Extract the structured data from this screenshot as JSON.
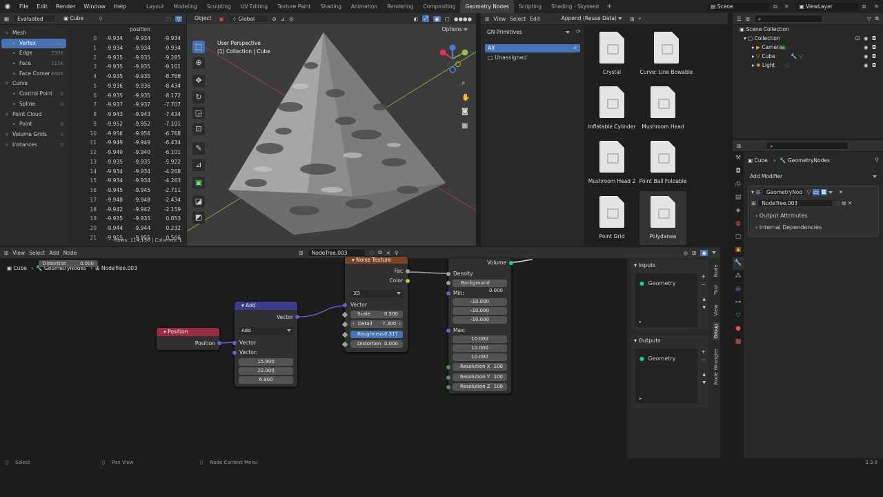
{
  "topbar": {
    "menus": [
      "File",
      "Edit",
      "Render",
      "Window",
      "Help"
    ],
    "workspaces": [
      "Layout",
      "Modeling",
      "Sculpting",
      "UV Editing",
      "Texture Paint",
      "Shading",
      "Animation",
      "Rendering",
      "Compositing",
      "Geometry Nodes",
      "Scripting",
      "Shading - Skyseed"
    ],
    "active_workspace": "Geometry Nodes",
    "scene": "Scene",
    "view_layer": "ViewLayer"
  },
  "spreadsheet": {
    "mode": "Evaluated",
    "object": "Cube",
    "column_header": "position",
    "domains": [
      {
        "label": "Mesh",
        "count": "",
        "indent": 0
      },
      {
        "label": "Vertex",
        "count": "114K",
        "indent": 1,
        "selected": true
      },
      {
        "label": "Edge",
        "count": "230K",
        "indent": 1
      },
      {
        "label": "Face",
        "count": "115K",
        "indent": 1
      },
      {
        "label": "Face Corner",
        "count": "460K",
        "indent": 1
      },
      {
        "label": "Curve",
        "count": "",
        "indent": 0
      },
      {
        "label": "Control Point",
        "count": "0",
        "indent": 1
      },
      {
        "label": "Spline",
        "count": "0",
        "indent": 1
      },
      {
        "label": "Point Cloud",
        "count": "",
        "indent": 0
      },
      {
        "label": "Point",
        "count": "0",
        "indent": 1
      },
      {
        "label": "Volume Grids",
        "count": "0",
        "indent": 0
      },
      {
        "label": "Instances",
        "count": "0",
        "indent": 0
      }
    ],
    "rows": [
      [
        "0",
        "-9.934",
        "-9.934",
        "-9.934"
      ],
      [
        "1",
        "-9.934",
        "-9.934",
        "-9.934"
      ],
      [
        "2",
        "-9.935",
        "-9.935",
        "-9.285"
      ],
      [
        "3",
        "-9.935",
        "-9.935",
        "-9.101"
      ],
      [
        "4",
        "-9.935",
        "-9.935",
        "-8.768"
      ],
      [
        "5",
        "-9.936",
        "-9.936",
        "-8.434"
      ],
      [
        "6",
        "-9.935",
        "-9.935",
        "-8.172"
      ],
      [
        "7",
        "-9.937",
        "-9.937",
        "-7.707"
      ],
      [
        "8",
        "-9.943",
        "-9.943",
        "-7.434"
      ],
      [
        "9",
        "-9.952",
        "-9.952",
        "-7.101"
      ],
      [
        "10",
        "-9.956",
        "-9.956",
        "-6.768"
      ],
      [
        "11",
        "-9.949",
        "-9.949",
        "-6.434"
      ],
      [
        "12",
        "-9.940",
        "-9.940",
        "-6.101"
      ],
      [
        "13",
        "-9.935",
        "-9.935",
        "-5.922"
      ],
      [
        "14",
        "-9.934",
        "-9.934",
        "-4.268"
      ],
      [
        "15",
        "-9.934",
        "-9.934",
        "-4.263"
      ],
      [
        "16",
        "-9.945",
        "-9.945",
        "-2.711"
      ],
      [
        "17",
        "-9.948",
        "-9.948",
        "-2.434"
      ],
      [
        "18",
        "-9.942",
        "-9.942",
        "-2.159"
      ],
      [
        "19",
        "-9.935",
        "-9.935",
        "0.053"
      ],
      [
        "20",
        "-9.944",
        "-9.944",
        "0.232"
      ],
      [
        "21",
        "-9.955",
        "-9.955",
        "0.566"
      ]
    ],
    "footer_rows": "Rows: 114,130",
    "footer_cols": "Columns: 1"
  },
  "viewport": {
    "mode": "Object",
    "orientation": "Global",
    "options": "Options",
    "perspective": "User Perspective",
    "collection": "(1) Collection | Cube"
  },
  "filebrowser": {
    "menus": [
      "View",
      "Select",
      "Edit"
    ],
    "import_mode": "Append (Reuse Data)",
    "library": "GN Primitives",
    "catalog_all": "All",
    "catalog_unassigned": "Unassigned",
    "assets": [
      "Crystal",
      "Curve: Line Bowable",
      "Inflatable Cylinder",
      "Mushroom Head",
      "Mushroom Head 2",
      "Point Ball Foldable",
      "Point Grid",
      "Polydanea"
    ]
  },
  "outliner": {
    "root": "Scene Collection",
    "collection": "Collection",
    "items": [
      "Camera",
      "Cube",
      "Light"
    ]
  },
  "properties": {
    "object": "Cube",
    "modifier_crumb": "GeometryNodes",
    "add_modifier": "Add Modifier",
    "modifier_name": "GeometryNod",
    "tree_name": "NodeTree.003",
    "output_attributes": "Output Attributes",
    "internal_deps": "Internal Dependencies"
  },
  "nodeeditor": {
    "menus": [
      "View",
      "Select",
      "Add",
      "Node"
    ],
    "tree": "NodeTree.003",
    "breadcrumb": [
      "Cube",
      "GeometryNodes",
      "NodeTree.003"
    ],
    "tooltip_label": "Distortion",
    "tooltip_value": "0.000",
    "position_node": {
      "title": "Position",
      "output": "Position"
    },
    "add_node": {
      "title": "Add",
      "output": "Vector",
      "operation": "Add",
      "in1": "Vector",
      "in2": "Vector:",
      "x": "15.900",
      "y": "22.000",
      "z": "6.900"
    },
    "noise_node": {
      "title": "Noise Texture",
      "out_fac": "Fac",
      "out_color": "Color",
      "dims": "3D",
      "in_vector": "Vector",
      "scale_label": "Scale",
      "scale": "0.500",
      "detail_label": "Detail",
      "detail": "7.300",
      "rough_label": "Roughness",
      "rough": "0.317",
      "dist_label": "Distortion",
      "dist": "0.000"
    },
    "volume_node": {
      "out": "Volume",
      "density": "Density",
      "bg_label": "Background",
      "bg": "0.000",
      "min_label": "Min:",
      "min": [
        "-10.000",
        "-10.000",
        "-10.000"
      ],
      "max_label": "Max:",
      "max": [
        "10.000",
        "10.000",
        "10.000"
      ],
      "resx": "Resolution X",
      "resy": "Resolution Y",
      "resz": "Resolution Z",
      "res": "100"
    },
    "group": {
      "inputs": "Inputs",
      "outputs": "Outputs",
      "in_socket": "Geometry",
      "out_socket": "Geometry"
    },
    "side_tabs": [
      "Node",
      "Tool",
      "View",
      "Group",
      "Node Wrangler"
    ]
  },
  "status": {
    "select": "Select",
    "pan": "Pan View",
    "ctx": "Node Context Menu",
    "version": "3.3.0"
  },
  "colors": {
    "accent": "#4772b3",
    "position_hdr": "#9a2b45",
    "add_hdr": "#3b3c8c",
    "noise_hdr": "#7a4422",
    "geo_socket": "#00d4a3",
    "vec_socket": "#6363c7",
    "float_socket": "#a1a1a1"
  }
}
